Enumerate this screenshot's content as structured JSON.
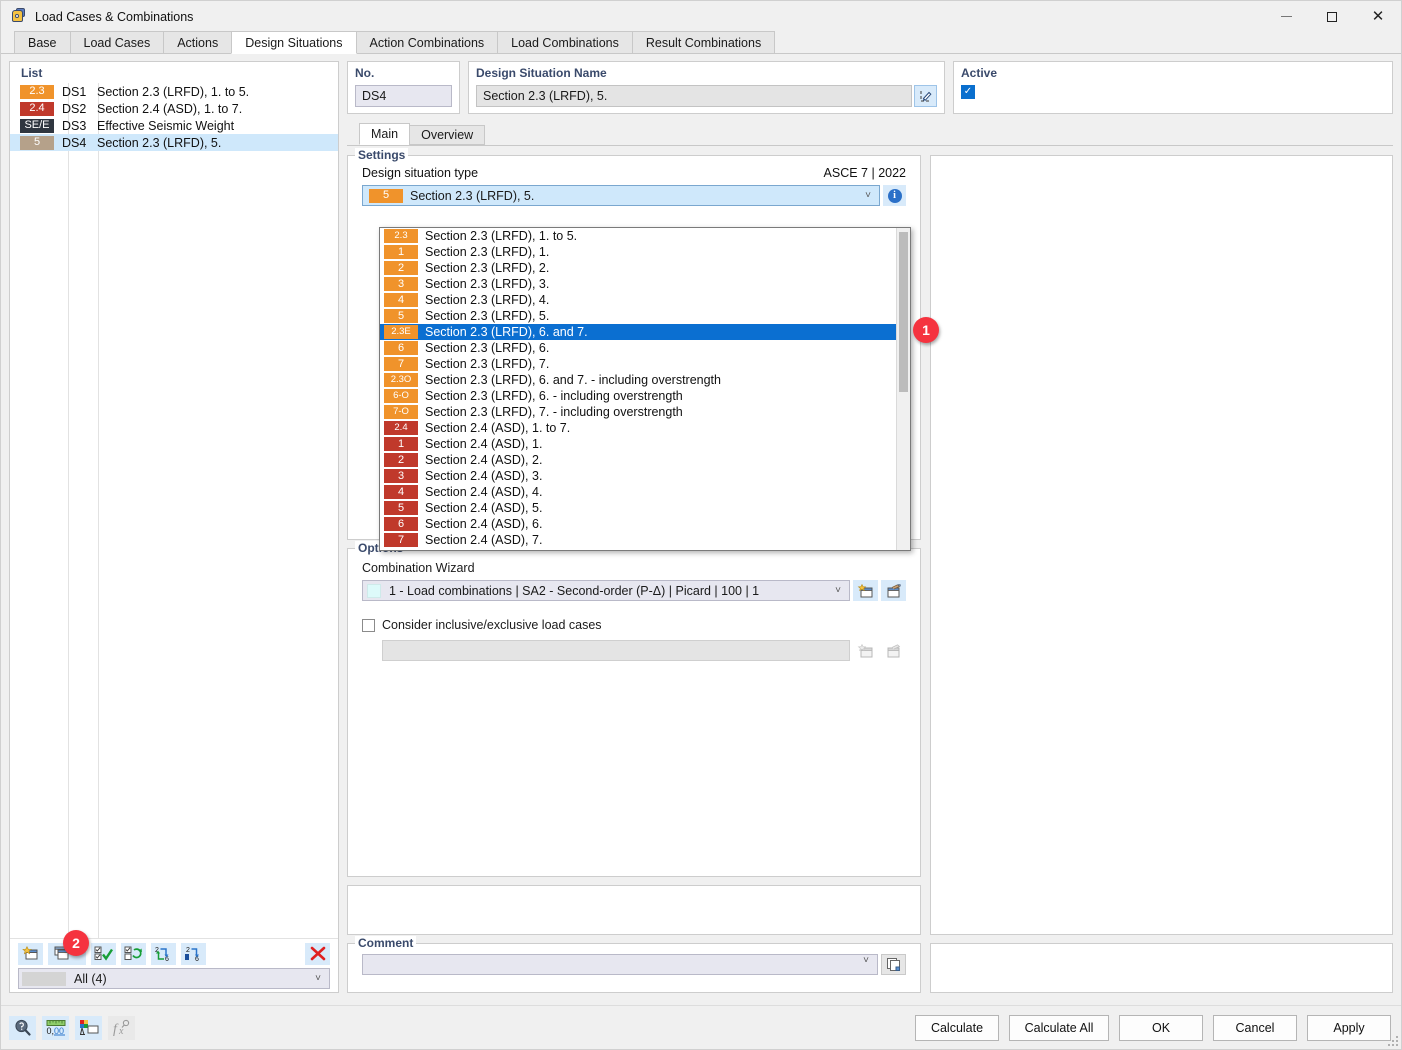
{
  "window": {
    "title": "Load Cases & Combinations",
    "icon": "keys-icon",
    "minimize": "minimize-icon",
    "maximize": "maximize-icon",
    "close": "close-icon"
  },
  "tabs": [
    {
      "label": "Base",
      "active": false
    },
    {
      "label": "Load Cases",
      "active": false
    },
    {
      "label": "Actions",
      "active": false
    },
    {
      "label": "Design Situations",
      "active": true
    },
    {
      "label": "Action Combinations",
      "active": false
    },
    {
      "label": "Load Combinations",
      "active": false
    },
    {
      "label": "Result Combinations",
      "active": false
    }
  ],
  "list": {
    "header": "List",
    "rows": [
      {
        "badge": "2.3",
        "badge_color": "#f0932b",
        "badge_text_color": "#ffffff",
        "no": "DS1",
        "name": "Section 2.3 (LRFD), 1. to 5.",
        "selected": false
      },
      {
        "badge": "2.4",
        "badge_color": "#c0392b",
        "badge_text_color": "#ffffff",
        "no": "DS2",
        "name": "Section 2.4 (ASD), 1. to 7.",
        "selected": false
      },
      {
        "badge": "SE/E",
        "badge_color": "#2f3640",
        "badge_text_color": "#ffffff",
        "no": "DS3",
        "name": "Effective Seismic Weight",
        "selected": false
      },
      {
        "badge": "5",
        "badge_color": "#b5a18a",
        "badge_text_color": "#ffffff",
        "no": "DS4",
        "name": "Section 2.3 (LRFD), 5.",
        "selected": true
      }
    ],
    "toolbar": [
      {
        "name": "new-item-button",
        "icon": "new-window-icon"
      },
      {
        "name": "copy-item-button",
        "icon": "copy-window-icon",
        "has_dropdown": true
      },
      {
        "name": "select-all-button",
        "icon": "check-all-icon"
      },
      {
        "name": "invert-selection-button",
        "icon": "invert-selection-icon"
      },
      {
        "name": "renumber-button",
        "icon": "renumber-icon"
      },
      {
        "name": "renumber-selected-button",
        "icon": "renumber-selected-icon"
      },
      {
        "name": "delete-item-button",
        "icon": "delete-x-icon"
      }
    ],
    "filter": {
      "label": "All (4)"
    },
    "callout": "2"
  },
  "fields": {
    "no_label": "No.",
    "no_value": "DS4",
    "name_label": "Design Situation Name",
    "name_value": "Section 2.3 (LRFD), 5.",
    "edit_icon": "edit-pencil-icon",
    "active_label": "Active",
    "active_checked": true
  },
  "inner_tabs": [
    {
      "label": "Main",
      "active": true
    },
    {
      "label": "Overview",
      "active": false
    }
  ],
  "settings": {
    "title": "Settings",
    "type_label": "Design situation type",
    "standard": "ASCE 7 | 2022",
    "selected": {
      "badge": "5",
      "badge_color": "#f0932b",
      "text": "Section 2.3 (LRFD), 5."
    },
    "info_icon": "info-icon",
    "callout": "1",
    "dropdown_items": [
      {
        "badge": "2.3",
        "color": "#f0932b",
        "text": "Section 2.3 (LRFD), 1. to 5.",
        "selected": false
      },
      {
        "badge": "1",
        "color": "#f0932b",
        "text": "Section 2.3 (LRFD), 1.",
        "selected": false
      },
      {
        "badge": "2",
        "color": "#f0932b",
        "text": "Section 2.3 (LRFD), 2.",
        "selected": false
      },
      {
        "badge": "3",
        "color": "#f0932b",
        "text": "Section 2.3 (LRFD), 3.",
        "selected": false
      },
      {
        "badge": "4",
        "color": "#f0932b",
        "text": "Section 2.3 (LRFD), 4.",
        "selected": false
      },
      {
        "badge": "5",
        "color": "#f0932b",
        "text": "Section 2.3 (LRFD), 5.",
        "selected": false
      },
      {
        "badge": "2.3E",
        "color": "#f0932b",
        "text": "Section 2.3 (LRFD), 6. and 7.",
        "selected": true
      },
      {
        "badge": "6",
        "color": "#f0932b",
        "text": "Section 2.3 (LRFD), 6.",
        "selected": false
      },
      {
        "badge": "7",
        "color": "#f0932b",
        "text": "Section 2.3 (LRFD), 7.",
        "selected": false
      },
      {
        "badge": "2.3O",
        "color": "#f0932b",
        "text": "Section 2.3 (LRFD), 6. and 7. - including overstrength",
        "selected": false
      },
      {
        "badge": "6-O",
        "color": "#f0932b",
        "text": "Section 2.3 (LRFD), 6. - including overstrength",
        "selected": false
      },
      {
        "badge": "7-O",
        "color": "#f0932b",
        "text": "Section 2.3 (LRFD), 7. - including overstrength",
        "selected": false
      },
      {
        "badge": "2.4",
        "color": "#c0392b",
        "text": "Section 2.4 (ASD), 1. to 7.",
        "selected": false
      },
      {
        "badge": "1",
        "color": "#c0392b",
        "text": "Section 2.4 (ASD), 1.",
        "selected": false
      },
      {
        "badge": "2",
        "color": "#c0392b",
        "text": "Section 2.4 (ASD), 2.",
        "selected": false
      },
      {
        "badge": "3",
        "color": "#c0392b",
        "text": "Section 2.4 (ASD), 3.",
        "selected": false
      },
      {
        "badge": "4",
        "color": "#c0392b",
        "text": "Section 2.4 (ASD), 4.",
        "selected": false
      },
      {
        "badge": "5",
        "color": "#c0392b",
        "text": "Section 2.4 (ASD), 5.",
        "selected": false
      },
      {
        "badge": "6",
        "color": "#c0392b",
        "text": "Section 2.4 (ASD), 6.",
        "selected": false
      },
      {
        "badge": "7",
        "color": "#c0392b",
        "text": "Section 2.4 (ASD), 7.",
        "selected": false
      }
    ]
  },
  "options": {
    "title": "Options",
    "wizard_label": "Combination Wizard",
    "wizard_value": "1 - Load combinations | SA2 - Second-order (P-Δ) | Picard | 100 | 1",
    "new_wizard_icon": "new-wizard-icon",
    "edit_wizard_icon": "edit-wizard-icon",
    "consider_label": "Consider inclusive/exclusive load cases",
    "consider_checked": false,
    "new_set_icon": "new-set-icon",
    "edit_set_icon": "edit-set-icon"
  },
  "comment": {
    "title": "Comment",
    "value": "",
    "copy_icon": "copy-comment-icon"
  },
  "footer": {
    "tools": [
      {
        "name": "help-button",
        "icon": "question-magnifier-icon",
        "enabled": true
      },
      {
        "name": "units-button",
        "icon": "ruler-units-icon",
        "enabled": true
      },
      {
        "name": "colors-button",
        "icon": "color-palette-icon",
        "enabled": true
      },
      {
        "name": "formula-button",
        "icon": "function-icon",
        "enabled": false
      }
    ],
    "buttons": [
      {
        "label": "Calculate",
        "name": "calculate-button"
      },
      {
        "label": "Calculate All",
        "name": "calculate-all-button"
      },
      {
        "label": "OK",
        "name": "ok-button"
      },
      {
        "label": "Cancel",
        "name": "cancel-button"
      },
      {
        "label": "Apply",
        "name": "apply-button"
      }
    ]
  },
  "colors": {
    "accent": "#0b6fd1",
    "orange_badge": "#f0932b",
    "red_badge": "#c0392b",
    "dark_badge": "#2f3640",
    "tan_badge": "#b5a18a",
    "callout_red": "#f5333f",
    "label_blue": "#3a4a6b"
  }
}
